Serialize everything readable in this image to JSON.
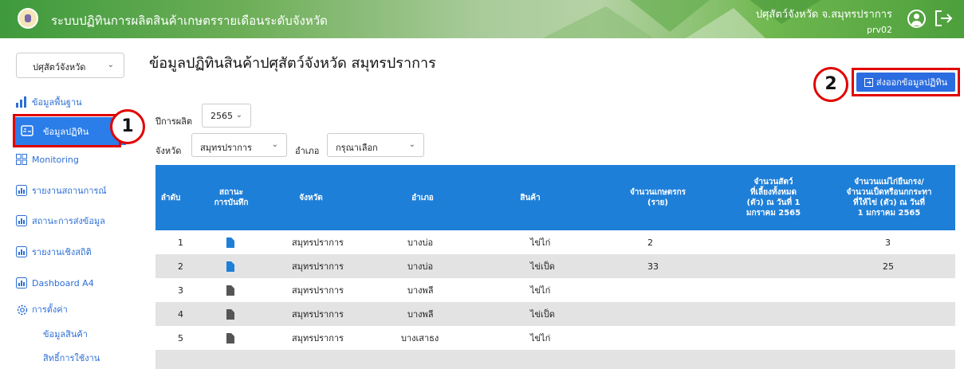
{
  "header": {
    "app_title": "ระบบปฏิทินการผลิตสินค้าเกษตรรายเดือนระดับจังหวัด",
    "user_name": "ปศุสัตว์จังหวัด จ.สมุทรปราการ",
    "user_id": "prv02"
  },
  "sidebar": {
    "role_select": "ปศุสัตว์จังหวัด",
    "items": [
      {
        "label": "ข้อมูลพื้นฐาน",
        "icon": "bar-chart-icon"
      },
      {
        "label": "ข้อมูลปฏิทิน",
        "icon": "calendar-icon"
      },
      {
        "label": "Monitoring",
        "icon": "grid-icon"
      },
      {
        "label": "รายงานสถานการณ์",
        "icon": "report-icon"
      },
      {
        "label": "สถานะการส่งข้อมูล",
        "icon": "report-icon"
      },
      {
        "label": "รายงานเชิงสถิติ",
        "icon": "report-icon"
      },
      {
        "label": "Dashboard A4",
        "icon": "report-icon"
      },
      {
        "label": "การตั้งค่า",
        "icon": "gear-icon"
      }
    ],
    "sub_items": [
      "ข้อมูลสินค้า",
      "สิทธิ์การใช้งาน"
    ]
  },
  "annotations": {
    "badge1": "1",
    "badge2": "2"
  },
  "main": {
    "title": "ข้อมูลปฏิทินสินค้าปศุสัตว์จังหวัด สมุทรปราการ",
    "export_button": "ส่งออกข้อมูลปฏิทิน",
    "filters": {
      "year_label": "ปีการผลิต",
      "year_value": "2565",
      "province_label": "จังหวัด",
      "province_value": "สมุทรปราการ",
      "district_label": "อำเภอ",
      "district_value": "กรุณาเลือก"
    },
    "table": {
      "headers": [
        "ลำดับ",
        "สถานะ\nการบันทึก",
        "จังหวัด",
        "อำเภอ",
        "สินค้า",
        "จำนวนเกษตรกร\n(ราย)",
        "จำนวนสัตว์\nที่เลี้ยงทั้งหมด\n(ตัว) ณ วันที่ 1\nมกราคม 2565",
        "จำนวนแม่ไก่ยืนกรง/\nจำนวนเป็ดหรือนกกระทา\nที่ให้ไข่ (ตัว) ณ วันที่\n1 มกราคม 2565"
      ],
      "rows": [
        {
          "no": "1",
          "status": "saved",
          "province": "สมุทรปราการ",
          "district": "บางบ่อ",
          "product": "ไข่ไก่",
          "farmers": "2",
          "animals": "",
          "layers": "3"
        },
        {
          "no": "2",
          "status": "saved",
          "province": "สมุทรปราการ",
          "district": "บางบ่อ",
          "product": "ไข่เป็ด",
          "farmers": "33",
          "animals": "",
          "layers": "25"
        },
        {
          "no": "3",
          "status": "empty",
          "province": "สมุทรปราการ",
          "district": "บางพลี",
          "product": "ไข่ไก่",
          "farmers": "",
          "animals": "",
          "layers": ""
        },
        {
          "no": "4",
          "status": "empty",
          "province": "สมุทรปราการ",
          "district": "บางพลี",
          "product": "ไข่เป็ด",
          "farmers": "",
          "animals": "",
          "layers": ""
        },
        {
          "no": "5",
          "status": "empty",
          "province": "สมุทรปราการ",
          "district": "บางเสาธง",
          "product": "ไข่ไก่",
          "farmers": "",
          "animals": "",
          "layers": ""
        }
      ]
    }
  },
  "colors": {
    "header_green": "#4c9f3c",
    "primary_blue": "#1e7fd8",
    "highlight_red": "#e10000"
  }
}
